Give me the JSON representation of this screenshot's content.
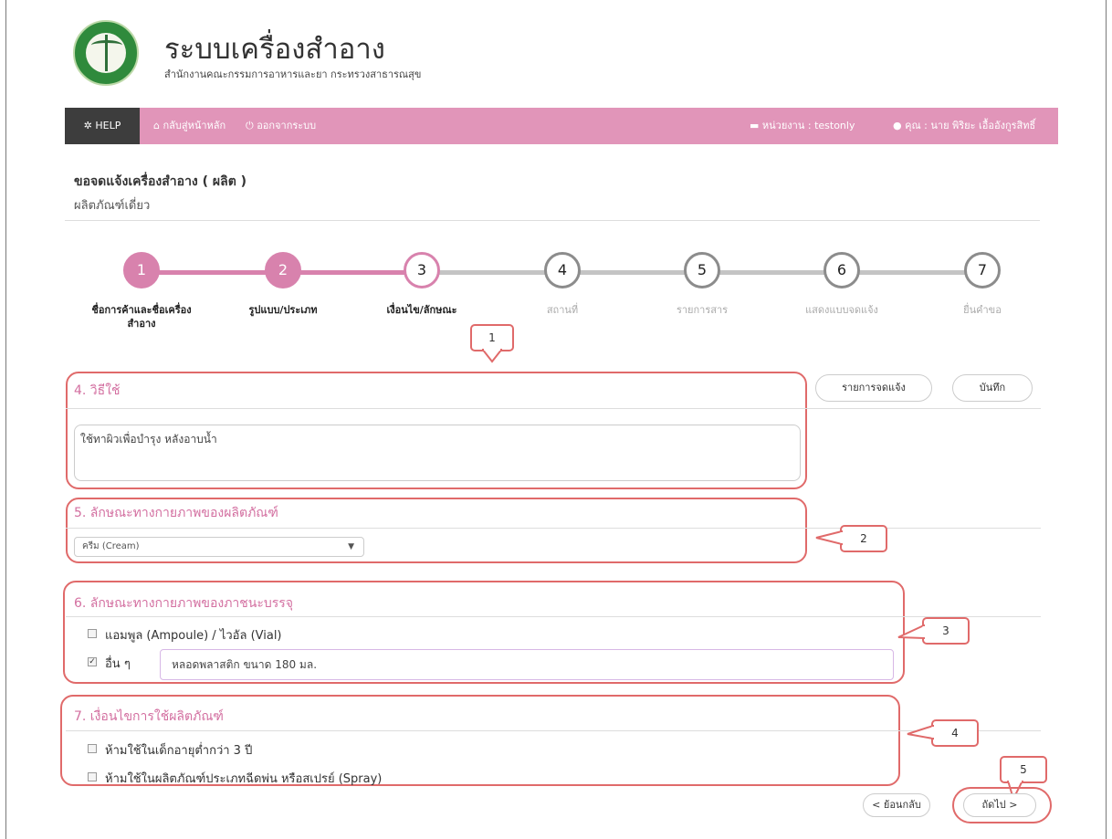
{
  "header": {
    "title": "ระบบเครื่องสำอาง",
    "subtitle": "สำนักงานคณะกรรมการอาหารและยา กระทรวงสาธารณสุข"
  },
  "navbar": {
    "help": "HELP",
    "home": "กลับสู่หน้าหลัก",
    "logout": "ออกจากระบบ",
    "unit": "หน่วยงาน : testonly",
    "user": "คุณ : นาย พิริยะ เอื้ออังกูรสิทธิ์"
  },
  "page": {
    "title": "ขอจดแจ้งเครื่องสำอาง ( ผลิต )",
    "subtitle": "ผลิตภัณฑ์เดี่ยว"
  },
  "steps": [
    {
      "number": "1",
      "label": "ชื่อการค้าและชื่อเครื่องสำอาง",
      "state": "done"
    },
    {
      "number": "2",
      "label": "รูปแบบ/ประเภท",
      "state": "done"
    },
    {
      "number": "3",
      "label": "เงื่อนไข/ลักษณะ",
      "state": "current"
    },
    {
      "number": "4",
      "label": "สถานที่",
      "state": "todo"
    },
    {
      "number": "5",
      "label": "รายการสาร",
      "state": "todo"
    },
    {
      "number": "6",
      "label": "แสดงแบบจดแจ้ง",
      "state": "todo"
    },
    {
      "number": "7",
      "label": "ยื่นคำขอ",
      "state": "todo"
    }
  ],
  "buttons": {
    "notification_list": "รายการจดแจ้ง",
    "save": "บันทึก",
    "back": "< ย้อนกลับ",
    "next": "ถัดไป >"
  },
  "section4": {
    "title": "4. วิธีใช้",
    "value": "ใช้ทาผิวเพื่อบำรุง หลังอาบน้ำ"
  },
  "section5": {
    "title": "5. ลักษณะทางกายภาพของผลิตภัณฑ์",
    "selected": "ครีม (Cream)",
    "arrow": "▼"
  },
  "section6": {
    "title": "6. ลักษณะทางกายภาพของภาชนะบรรจุ",
    "options": [
      {
        "label": "แอมพูล (Ampoule) / ไวอัล (Vial)",
        "checked": false
      },
      {
        "label": "อื่น ๆ",
        "checked": true
      }
    ],
    "other_value": "หลอดพลาสติก ขนาด 180 มล."
  },
  "section7": {
    "title": "7. เงื่อนไขการใช้ผลิตภัณฑ์",
    "options": [
      {
        "label": "ห้ามใช้ในเด็กอายุต่ำกว่า 3 ปี",
        "checked": false
      },
      {
        "label": "ห้ามใช้ในผลิตภัณฑ์ประเภทฉีดพ่น หรือสเปรย์ (Spray)",
        "checked": false
      }
    ]
  },
  "callouts": [
    "1",
    "2",
    "3",
    "4",
    "5"
  ],
  "colors": {
    "nav": "#e195b9",
    "accent": "#d882ad",
    "callout": "#e06a6a"
  },
  "icons": {
    "help": "gear-icon",
    "home": "home-icon",
    "logout": "power-icon",
    "unit": "briefcase-icon",
    "user": "user-icon"
  }
}
